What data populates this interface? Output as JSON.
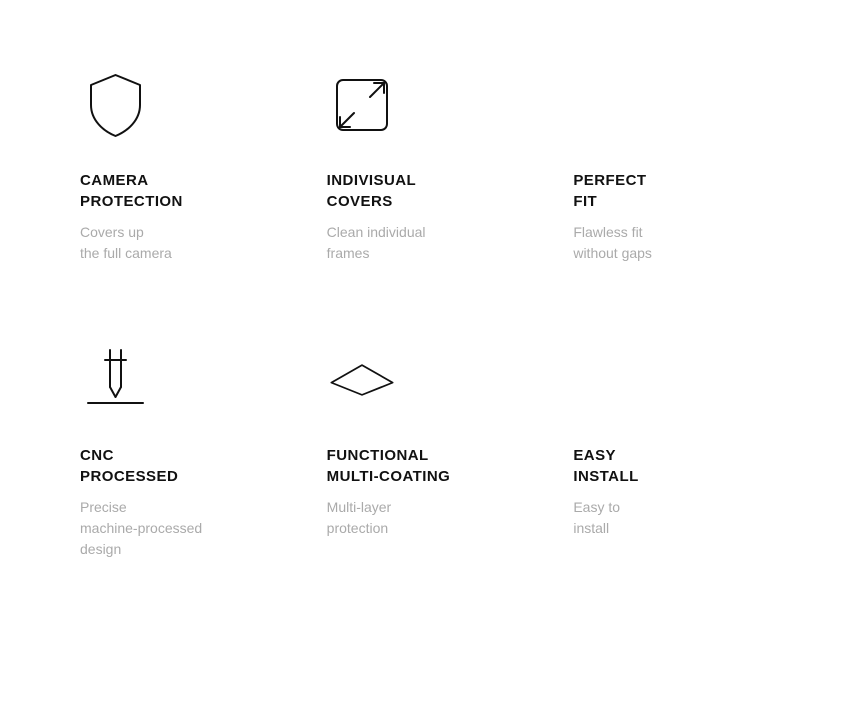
{
  "features": [
    {
      "id": "camera-protection",
      "icon": "shield",
      "title_line1": "CAMERA",
      "title_line2": "PROTECTION",
      "desc_line1": "Covers up",
      "desc_line2": "the full camera"
    },
    {
      "id": "individual-covers",
      "icon": "expand",
      "title_line1": "INDIVISUAL",
      "title_line2": "COVERS",
      "desc_line1": "Clean individual",
      "desc_line2": "frames"
    },
    {
      "id": "perfect-fit",
      "icon": null,
      "title_line1": "PERFECT",
      "title_line2": "FIT",
      "desc_line1": "Flawless fit",
      "desc_line2": "without gaps"
    },
    {
      "id": "cnc-processed",
      "icon": "cnc",
      "title_line1": "CNC",
      "title_line2": "PROCESSED",
      "desc_line1": "Precise",
      "desc_line2": "machine-processed",
      "desc_line3": "design"
    },
    {
      "id": "functional-multicoating",
      "icon": "diamond",
      "title_line1": "FUNCTIONAL",
      "title_line2": "MULTI-COATING",
      "desc_line1": "Multi-layer",
      "desc_line2": "protection"
    },
    {
      "id": "easy-install",
      "icon": null,
      "title_line1": "EASY",
      "title_line2": "INSTALL",
      "desc_line1": "Easy to",
      "desc_line2": "install"
    }
  ]
}
